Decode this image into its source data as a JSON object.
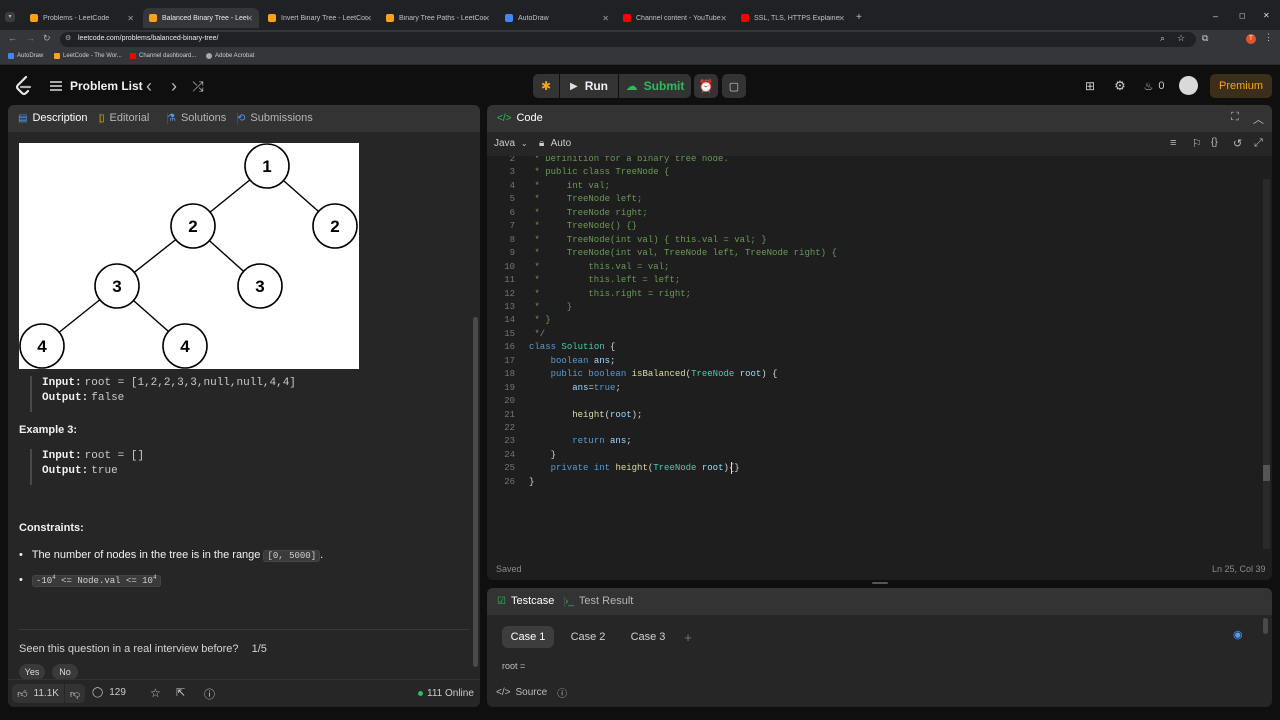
{
  "browser": {
    "tabs": [
      {
        "title": "Problems - LeetCode",
        "active": false
      },
      {
        "title": "Balanced Binary Tree - LeetCode",
        "active": true
      },
      {
        "title": "Invert Binary Tree - LeetCode",
        "active": false
      },
      {
        "title": "Binary Tree Paths - LeetCode",
        "active": false
      },
      {
        "title": "AutoDraw",
        "active": false
      },
      {
        "title": "Channel content - YouTube Studio",
        "active": false
      },
      {
        "title": "SSL, TLS, HTTPS Explained - YouTube",
        "active": false
      }
    ],
    "new_tab": "+",
    "url": "leetcode.com/problems/balanced-binary-tree/",
    "bookmarks": [
      "AutoDraw",
      "LeetCode - The Wor...",
      "Channel dashboard...",
      "Adobe Acrobat"
    ],
    "profile_letter": "T",
    "win_controls": [
      "–",
      "◻",
      "✕"
    ],
    "close_glyph": "✕",
    "nav_glyphs": [
      "←",
      "→",
      "↻"
    ],
    "omnibox_glyphs": [
      "⌕",
      "☆",
      "⧉"
    ]
  },
  "nav": {
    "problem_list": "Problem List",
    "prev": "‹",
    "next": "›",
    "shuffle": "⤮",
    "run": "Run",
    "submit": "Submit",
    "streak": "0",
    "premium": "Premium"
  },
  "description": {
    "tabs": [
      {
        "label": "Description",
        "icon": "description-icon",
        "color": "#4e9bf5"
      },
      {
        "label": "Editorial",
        "icon": "editorial-icon",
        "color": "#ffb800"
      },
      {
        "label": "Solutions",
        "icon": "solutions-icon",
        "color": "#4e9bf5"
      },
      {
        "label": "Submissions",
        "icon": "submissions-icon",
        "color": "#4e9bf5"
      }
    ],
    "tree_nodes": [
      "1",
      "2",
      "2",
      "3",
      "3",
      "4",
      "4"
    ],
    "example2": {
      "input_label": "Input:",
      "input_value": "root = [1,2,2,3,3,null,null,4,4]",
      "output_label": "Output:",
      "output_value": "false"
    },
    "example3": {
      "title": "Example 3:",
      "input_label": "Input:",
      "input_value": "root = []",
      "output_label": "Output:",
      "output_value": "true"
    },
    "constraints_title": "Constraints:",
    "constraint1_text": "The number of nodes in the tree is in the range",
    "constraint1_code": "[0, 5000]",
    "constraint1_end": ".",
    "constraint2_lhs": "-10",
    "constraint2_mid": " <= Node.val <= 10",
    "constraint2_exp": "4",
    "bullet": "•",
    "interview_question": "Seen this question in a real interview before?",
    "interview_count": "1/5",
    "yes": "Yes",
    "no": "No",
    "likes": "11.1K",
    "comments": "129",
    "online": "111 Online"
  },
  "code": {
    "title": "Code",
    "language": "Java",
    "auto": "Auto",
    "status": "Saved",
    "cursor": "Ln 25, Col 39",
    "lines": [
      {
        "n": "2",
        "t": " * Definition for a binary tree node."
      },
      {
        "n": "3",
        "t": " * public class TreeNode {"
      },
      {
        "n": "4",
        "t": " *     int val;"
      },
      {
        "n": "5",
        "t": " *     TreeNode left;"
      },
      {
        "n": "6",
        "t": " *     TreeNode right;"
      },
      {
        "n": "7",
        "t": " *     TreeNode() {}"
      },
      {
        "n": "8",
        "t": " *     TreeNode(int val) { this.val = val; }"
      },
      {
        "n": "9",
        "t": " *     TreeNode(int val, TreeNode left, TreeNode right) {"
      },
      {
        "n": "10",
        "t": " *         this.val = val;"
      },
      {
        "n": "11",
        "t": " *         this.left = left;"
      },
      {
        "n": "12",
        "t": " *         this.right = right;"
      },
      {
        "n": "13",
        "t": " *     }"
      },
      {
        "n": "14",
        "t": " * }"
      },
      {
        "n": "15",
        "t": " */"
      },
      {
        "n": "16",
        "t": "class Solution {"
      },
      {
        "n": "17",
        "t": "    boolean ans;"
      },
      {
        "n": "18",
        "t": "    public boolean isBalanced(TreeNode root) {"
      },
      {
        "n": "19",
        "t": "        ans=true;"
      },
      {
        "n": "20",
        "t": ""
      },
      {
        "n": "21",
        "t": "        height(root);"
      },
      {
        "n": "22",
        "t": ""
      },
      {
        "n": "23",
        "t": "        return ans;"
      },
      {
        "n": "24",
        "t": "    }"
      },
      {
        "n": "25",
        "t": "    private int height(TreeNode root){}"
      },
      {
        "n": "26",
        "t": "}"
      }
    ]
  },
  "testcase": {
    "tab_testcase": "Testcase",
    "tab_result": "Test Result",
    "cases": [
      "Case 1",
      "Case 2",
      "Case 3"
    ],
    "add": "+",
    "root_label": "root =",
    "source": "Source"
  }
}
